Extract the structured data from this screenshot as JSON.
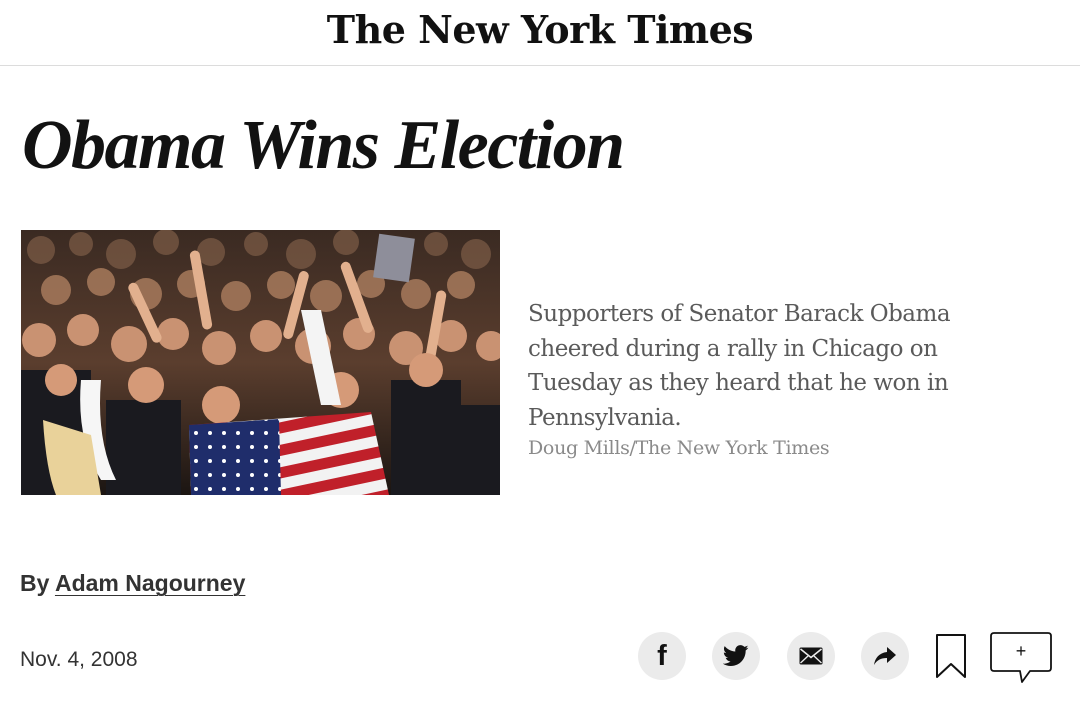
{
  "masthead": {
    "logo_text": "The New York Times"
  },
  "article": {
    "headline": "Obama Wins Election",
    "image": {
      "caption": "Supporters of Senator Barack Obama cheered during a rally in Chicago on Tuesday as they heard that he won in Pennsylvania.",
      "credit": "Doug Mills/The New York Times"
    },
    "byline_prefix": "By",
    "author": "Adam Nagourney",
    "date": "Nov. 4, 2008"
  },
  "share_tools": {
    "facebook_icon": "f",
    "comment_icon": "+"
  },
  "icons": [
    "facebook-icon",
    "twitter-icon",
    "email-icon",
    "share-arrow-icon",
    "bookmark-icon",
    "comment-icon"
  ]
}
